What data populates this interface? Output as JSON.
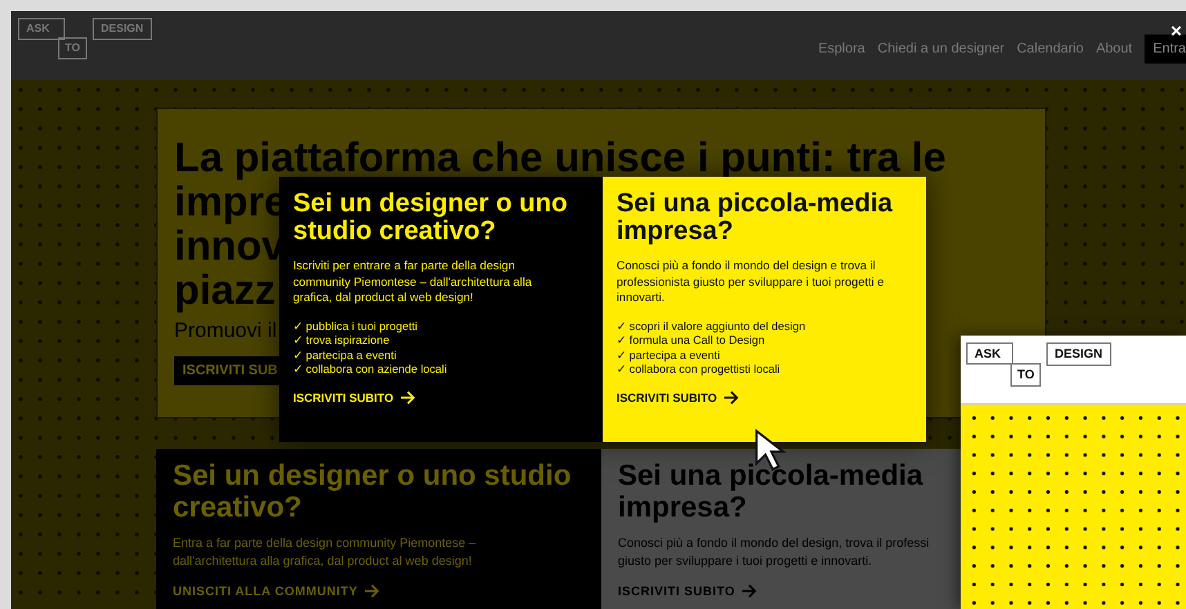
{
  "header": {
    "logo": [
      "ASK",
      "TO",
      "DESIGN"
    ],
    "nav": [
      "Esplora",
      "Chiedi a un designer",
      "Calendario",
      "About"
    ],
    "login": "Entra",
    "close": "×"
  },
  "hero": {
    "title_lines": [
      "La piattaforma che unisce i punti: tra le",
      "impre",
      "innov",
      "piazz"
    ],
    "subtitle": "Promuovi il",
    "button": "ISCRIVITI SUB"
  },
  "background_cards": [
    {
      "kind": "dark",
      "title": "Sei un designer o uno studio creativo?",
      "body_lines": [
        "Entra a far parte della design community Piemontese –",
        "dall'architettura alla grafica, dal product al web design!"
      ],
      "cta": "UNISCITI ALLA COMMUNITY"
    },
    {
      "kind": "grey",
      "title": "Sei una piccola-media impresa?",
      "body_lines": [
        "Conosci più a fondo il mondo del design, trova il professi",
        "giusto per sviluppare i tuoi progetti e innovarti."
      ],
      "cta": "ISCRIVITI SUBITO"
    }
  ],
  "modal": {
    "panels": [
      {
        "kind": "dark",
        "title": "Sei un designer o uno studio creativo?",
        "body": "Iscriviti per entrare a far parte della design community Piemontese – dall'architettura alla grafica, dal product al web design!",
        "items": [
          "✓ pubblica i tuoi progetti",
          "✓ trova ispirazione",
          "✓ partecipa a eventi",
          "✓ collabora con aziende locali"
        ],
        "cta": "ISCRIVITI SUBITO"
      },
      {
        "kind": "yellow",
        "title": "Sei una piccola-media impresa?",
        "body": "Conosci più a fondo il mondo del design e trova il professionista giusto per sviluppare i tuoi progetti e innovarti.",
        "items": [
          "✓ scopri il valore aggiunto del design",
          "✓ formula una Call to Design",
          "✓ partecipa a eventi",
          "✓ collabora con progettisti locali"
        ],
        "cta": "ISCRIVITI SUBITO"
      }
    ]
  },
  "preview": {
    "logo": [
      "ASK",
      "TO",
      "DESIGN"
    ]
  }
}
